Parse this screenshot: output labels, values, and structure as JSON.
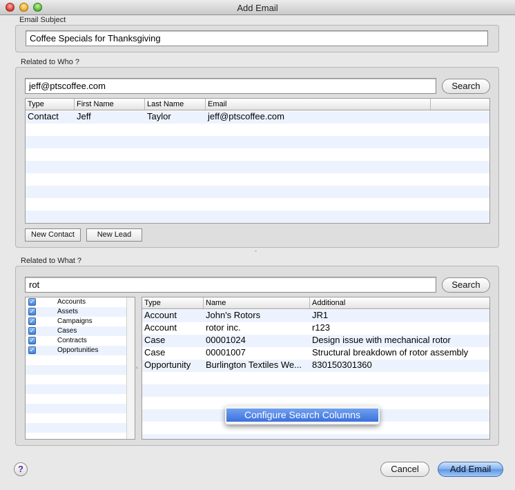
{
  "window": {
    "title": "Add Email"
  },
  "email_subject": {
    "label": "Email Subject",
    "value": "Coffee Specials for Thanksgiving"
  },
  "related_who": {
    "label": "Related to Who ?",
    "search_value": "jeff@ptscoffee.com",
    "search_button": "Search",
    "columns": [
      "Type",
      "First Name",
      "Last Name",
      "Email"
    ],
    "rows": [
      {
        "type": "Contact",
        "first_name": "Jeff",
        "last_name": "Taylor",
        "email": "jeff@ptscoffee.com"
      }
    ],
    "new_contact_button": "New Contact",
    "new_lead_button": "New Lead"
  },
  "related_what": {
    "label": "Related to What ?",
    "search_value": "rot",
    "search_button": "Search",
    "object_types": [
      {
        "label": "Accounts",
        "checked": true
      },
      {
        "label": "Assets",
        "checked": true
      },
      {
        "label": "Campaigns",
        "checked": true
      },
      {
        "label": "Cases",
        "checked": true
      },
      {
        "label": "Contracts",
        "checked": true
      },
      {
        "label": "Opportunities",
        "checked": true
      }
    ],
    "columns": [
      "Type",
      "Name",
      "Additional"
    ],
    "rows": [
      {
        "type": "Account",
        "name": "John's Rotors",
        "additional": "JR1"
      },
      {
        "type": "Account",
        "name": "rotor inc.",
        "additional": "r123"
      },
      {
        "type": "Case",
        "name": "00001024",
        "additional": "Design issue with mechanical rotor"
      },
      {
        "type": "Case",
        "name": "00001007",
        "additional": "Structural breakdown of rotor assembly"
      },
      {
        "type": "Opportunity",
        "name": "Burlington Textiles We...",
        "additional": "830150301360"
      }
    ]
  },
  "context_menu": {
    "item": "Configure Search Columns"
  },
  "footer": {
    "help": "?",
    "cancel_button": "Cancel",
    "add_button": "Add Email"
  },
  "colors": {
    "accent": "#3d71dc",
    "row_stripe": "#edf3fe"
  }
}
